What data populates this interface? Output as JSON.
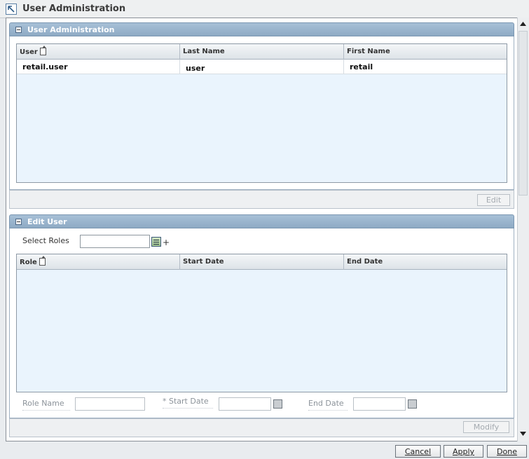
{
  "window": {
    "title": "User Administration"
  },
  "user_admin": {
    "title": "User Administration",
    "columns": [
      "User",
      "Last Name",
      "First Name"
    ],
    "rows": [
      {
        "user": "retail.user",
        "last_name": "user",
        "first_name": "retail"
      }
    ],
    "edit_label": "Edit"
  },
  "edit_user": {
    "title": "Edit User",
    "select_roles_label": "Select Roles",
    "select_roles_value": "",
    "plus_label": "+",
    "columns": [
      "Role",
      "Start Date",
      "End Date"
    ],
    "role_name_label": "Role Name",
    "start_date_label": "Start Date",
    "required_mark": "*",
    "end_date_label": "End Date",
    "modify_label": "Modify"
  },
  "footer": {
    "cancel_label": "Cancel",
    "apply_label": "Apply",
    "done_label": "Done"
  }
}
